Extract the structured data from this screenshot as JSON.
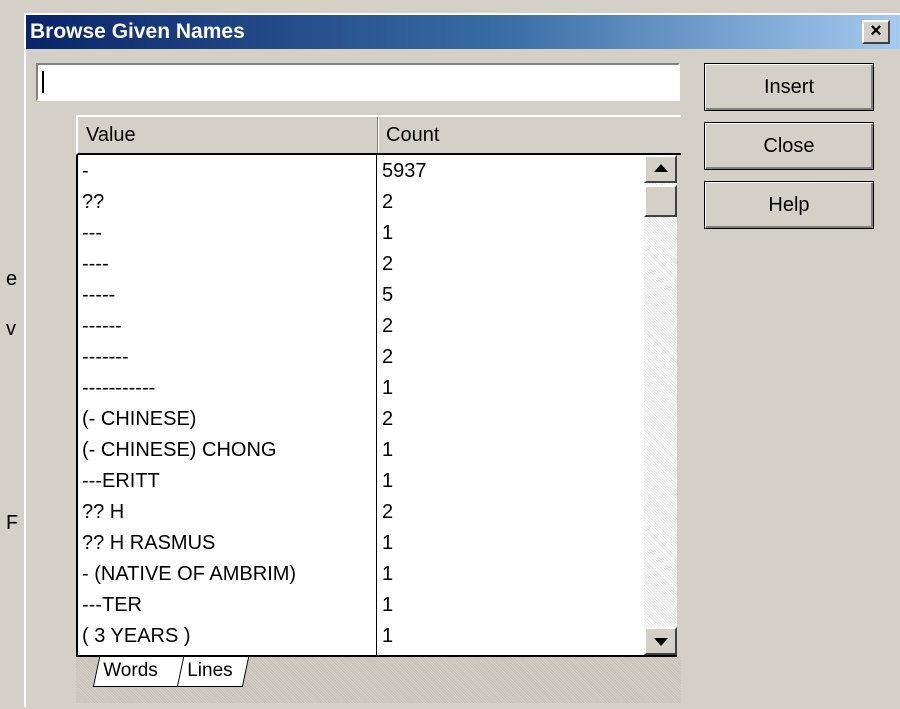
{
  "window": {
    "title": "Browse Given Names",
    "close_label": "×"
  },
  "background": {
    "chars": [
      "e",
      "v",
      "F"
    ]
  },
  "search": {
    "value": ""
  },
  "buttons": {
    "insert": "Insert",
    "close": "Close",
    "help": "Help"
  },
  "list": {
    "columns": [
      "Value",
      "Count"
    ],
    "rows": [
      {
        "value": "-",
        "count": "5937"
      },
      {
        "value": "??",
        "count": "2"
      },
      {
        "value": "---",
        "count": "1"
      },
      {
        "value": "----",
        "count": "2"
      },
      {
        "value": "-----",
        "count": "5"
      },
      {
        "value": "------",
        "count": "2"
      },
      {
        "value": "-------",
        "count": "2"
      },
      {
        "value": "-----------",
        "count": "1"
      },
      {
        "value": "(- CHINESE)",
        "count": "2"
      },
      {
        "value": "(- CHINESE) CHONG",
        "count": "1"
      },
      {
        "value": "---ERITT",
        "count": "1"
      },
      {
        "value": "?? H",
        "count": "2"
      },
      {
        "value": "?? H RASMUS",
        "count": "1"
      },
      {
        "value": "- (NATIVE OF AMBRIM)",
        "count": "1"
      },
      {
        "value": "---TER",
        "count": "1"
      },
      {
        "value": "( 3 YEARS )",
        "count": "1"
      }
    ]
  },
  "tabs": [
    "Words",
    "Lines"
  ]
}
